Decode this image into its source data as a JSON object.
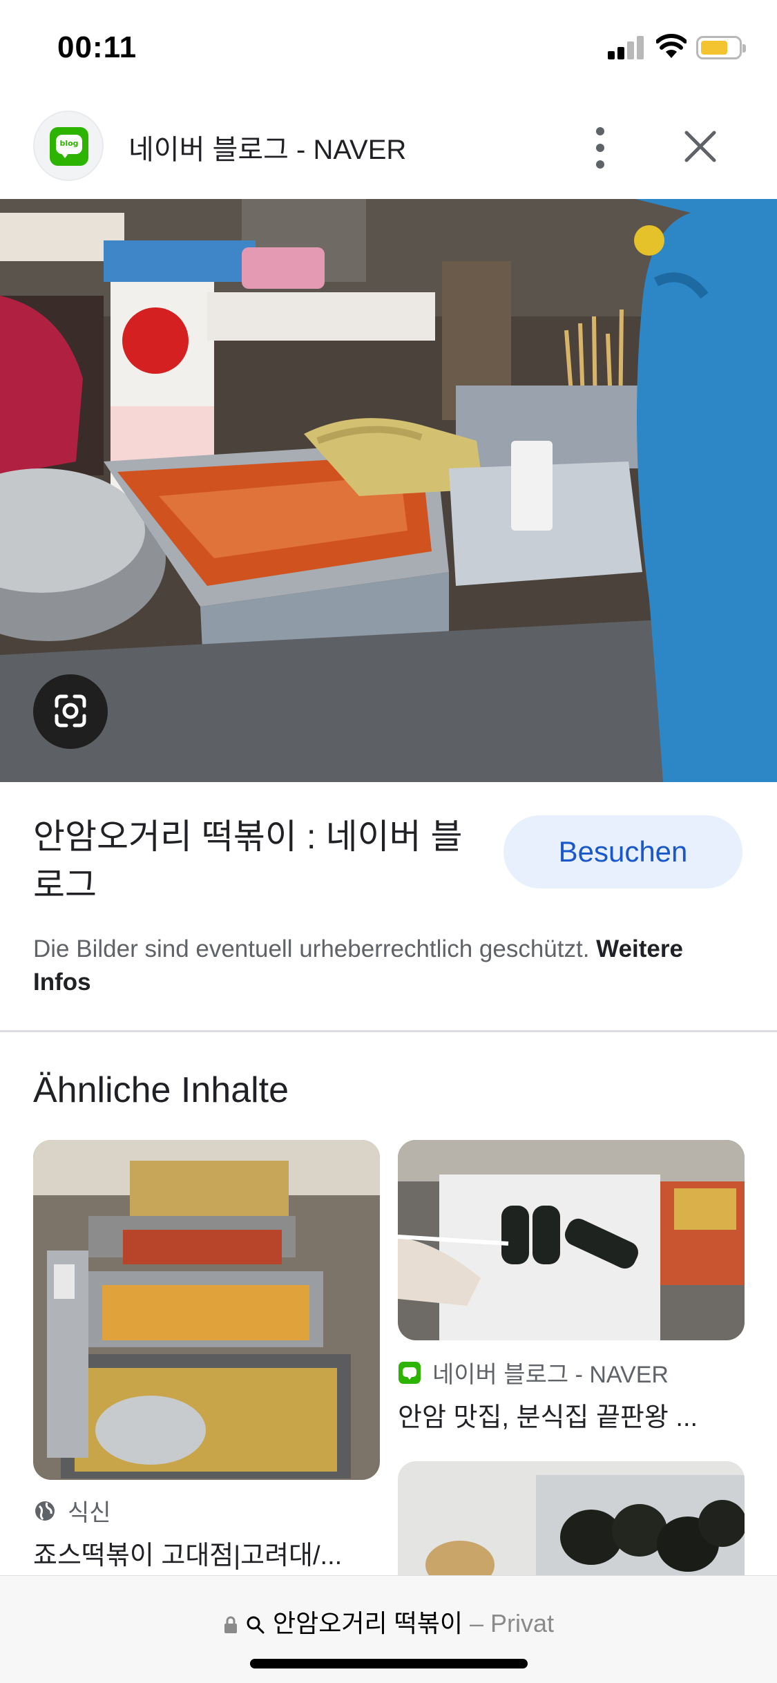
{
  "status_bar": {
    "time": "00:11"
  },
  "header": {
    "site_title": "네이버 블로그 - NAVER",
    "logo_text": "blog",
    "more_icon": "more-vert-icon",
    "close_icon": "close-icon"
  },
  "main_image": {
    "description_icon": "lens-icon"
  },
  "result": {
    "title": "안암오거리 떡볶이 : 네이버 블로그",
    "visit_label": "Besuchen",
    "copyright_text": "Die Bilder sind eventuell urheberrechtlich geschützt.",
    "copyright_link": "Weitere Infos"
  },
  "similar": {
    "heading": "Ähnliche Inhalte",
    "items": [
      {
        "source": "식신",
        "source_icon": "globe-icon",
        "title": "죠스떡볶이 고대점|고려대/..."
      },
      {
        "source": "네이버 블로그 - NAVER",
        "source_icon": "naver-blog-icon",
        "title": "안암 맛집, 분식집 끝판왕 ..."
      }
    ]
  },
  "url_bar": {
    "query": "안암오거리 떡볶이",
    "separator": " – ",
    "mode": "Privat"
  },
  "colors": {
    "accent": "#1a57c8",
    "visit_bg": "#e8f0fe",
    "naver_green": "#2db400"
  }
}
